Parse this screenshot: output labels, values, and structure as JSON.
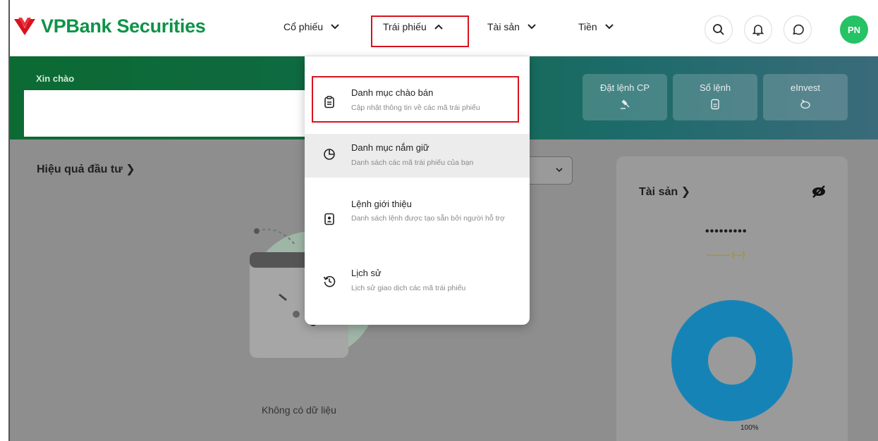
{
  "brand": {
    "name": "VPBank Securities",
    "green": "#0e9347",
    "red": "#d8131e"
  },
  "nav": {
    "items": [
      {
        "label": "Cổ phiếu",
        "state": "collapsed"
      },
      {
        "label": "Trái phiếu",
        "state": "expanded"
      },
      {
        "label": "Tài sản",
        "state": "collapsed"
      },
      {
        "label": "Tiền",
        "state": "collapsed"
      }
    ],
    "icons": [
      "search-icon",
      "bell-icon",
      "chat-icon"
    ],
    "avatar": "PN"
  },
  "banner": {
    "greeting": "Xin chào",
    "quick_actions": [
      {
        "label": "Đặt lệnh CP",
        "icon": "gavel-icon"
      },
      {
        "label": "Sổ lệnh",
        "icon": "document-icon"
      },
      {
        "label": "eInvest",
        "icon": "piggy-bank-icon"
      }
    ]
  },
  "performance": {
    "title": "Hiệu quả đầu tư",
    "empty_text": "Không có dữ liệu"
  },
  "assets": {
    "title": "Tài sản",
    "masked_total": "•••••••••",
    "masked_change": "--------- (---)",
    "percent_label": "100%",
    "donut_color": "#1a9ad6"
  },
  "dropdown": {
    "items": [
      {
        "title": "Danh mục chào bán",
        "subtitle": "Cập nhật thông tin về các mã trái phiếu",
        "icon": "clipboard-icon"
      },
      {
        "title": "Danh mục nắm giữ",
        "subtitle": "Danh sách các mã trái phiếu của bạn",
        "icon": "pie-chart-icon"
      },
      {
        "title": "Lệnh giới thiệu",
        "subtitle": "Danh sách lệnh được tạo sẵn bởi người hỗ trợ",
        "icon": "user-file-icon"
      },
      {
        "title": "Lịch sử",
        "subtitle": "Lịch sử giao dịch các mã trái phiếu",
        "icon": "history-icon"
      }
    ]
  }
}
